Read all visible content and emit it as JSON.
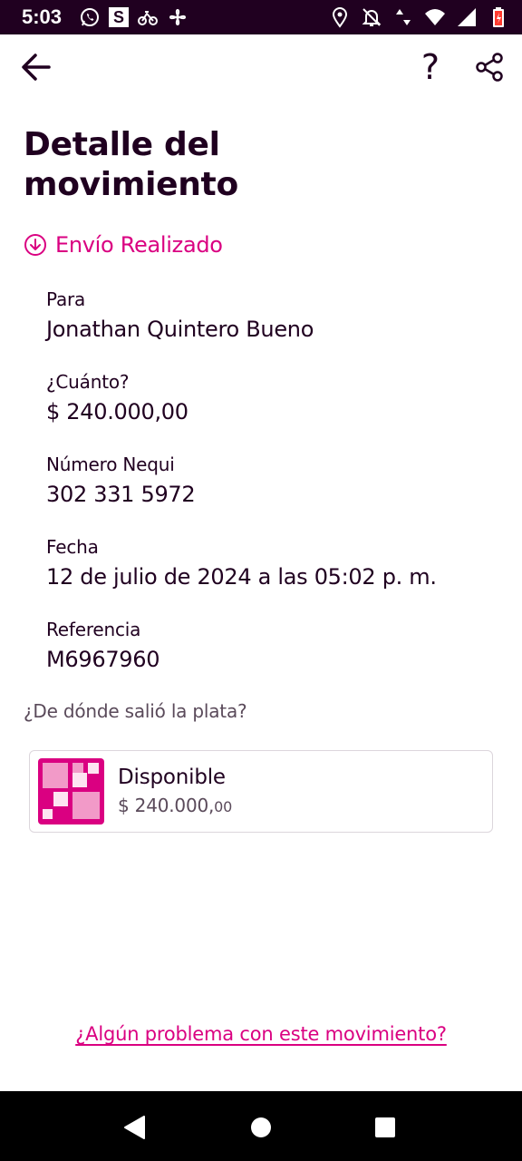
{
  "status_bar": {
    "time": "5:03",
    "left_icons": [
      "whatsapp-icon",
      "s-app-icon",
      "bike-icon",
      "fan-icon"
    ],
    "s_label": "S",
    "right_icons": [
      "location-icon",
      "bell-off-icon",
      "data-arrows-icon",
      "wifi-icon",
      "signal-icon",
      "battery-icon"
    ],
    "battery_color": "#ff3b30"
  },
  "app_bar": {
    "back_icon": "arrow-left-icon",
    "help_label": "?",
    "share_icon": "share-icon"
  },
  "page": {
    "title": "Detalle del movimiento"
  },
  "movement": {
    "status": "Envío Realizado",
    "status_icon": "arrow-circle-down-icon",
    "accent_color": "#da0081",
    "fields": [
      {
        "label": "Para",
        "value": "Jonathan Quintero Bueno"
      },
      {
        "label": "¿Cuánto?",
        "value": "$ 240.000,00"
      },
      {
        "label": "Número Nequi",
        "value": "302 331 5972"
      },
      {
        "label": "Fecha",
        "value": "12 de julio de 2024 a las 05:02 p. m."
      },
      {
        "label": "Referencia",
        "value": "M6967960"
      }
    ]
  },
  "source": {
    "question": "¿De dónde salió la plata?",
    "account": {
      "name": "Disponible",
      "balance_main": "$ 240.000,",
      "balance_cents": "00",
      "logo_icon": "nequi-squares-logo"
    }
  },
  "footer": {
    "problem_link": "¿Algún problema con este movimiento?"
  },
  "nav_bar": {
    "back_icon": "triangle-back-icon",
    "home_icon": "circle-home-icon",
    "recents_icon": "square-recents-icon"
  }
}
